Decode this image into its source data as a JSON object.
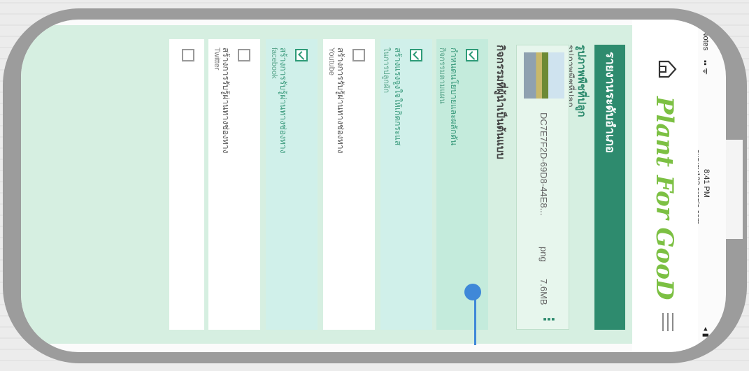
{
  "status_bar": {
    "carrier": "◀ Notes",
    "time": "8:41 PM",
    "url": "survey123.arcgis.com"
  },
  "header": {
    "logo": "Plant For GooD"
  },
  "form": {
    "title": "รายงานระดับอำเภอ",
    "section_photo_title": "รูปภาพพืชที่ปลูก",
    "section_photo_sub": "รูปภาพพืชที่ปลูก",
    "file": {
      "name": "DC7E7F2D-69D8-44E8...",
      "ext": "png",
      "size": "7.6MB"
    },
    "activities_title": "กิจกรรมที่ผู้นำเป็นต้นแบบ",
    "cards": [
      {
        "title": "กำหนดนโยบายและผลักดัน",
        "sub": "กิจกรรมตามแผน",
        "checked": true,
        "highlight": true
      },
      {
        "title": "สร้างแรงจูงใจให้เกิดกระแส",
        "sub": "ในการปลูกผัก",
        "checked": true,
        "highlight": true
      },
      {
        "title": "สร้างการรับรู้ผ่านทางช่องทาง",
        "sub": "Youtube",
        "checked": false,
        "highlight": false
      },
      {
        "title": "สร้างการรับรู้ผ่านทางช่องทาง",
        "sub": "facebook",
        "checked": true,
        "highlight": true
      },
      {
        "title": "สร้างการรับรู้ผ่านทางช่องทาง",
        "sub": "Twitter",
        "checked": false,
        "highlight": false
      },
      {
        "title": "",
        "sub": "",
        "checked": false,
        "highlight": false
      }
    ]
  },
  "colors": {
    "accent": "#2e8b6e",
    "mint": "#d6efe1",
    "logo_green": "#7cc043",
    "pointer": "#3f88d8"
  }
}
